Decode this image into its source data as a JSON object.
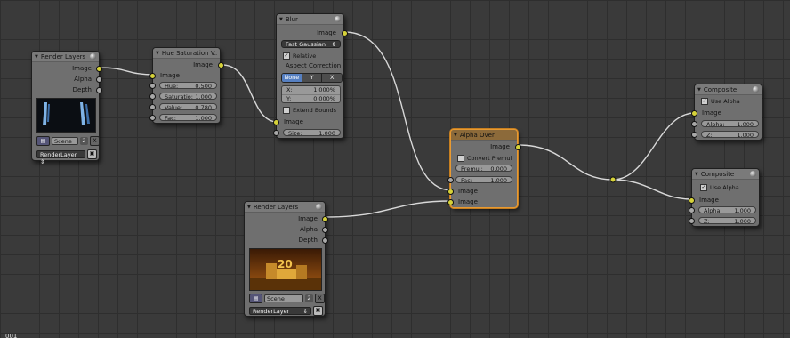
{
  "frame_label": "001",
  "nodes": {
    "render_layers_1": {
      "title": "Render Layers",
      "outputs": [
        "Image",
        "Alpha",
        "Depth"
      ],
      "scene": {
        "icon": "scene-icon",
        "name": "Scene",
        "count": "2",
        "close": "X"
      },
      "layer": {
        "name": "RenderLayer",
        "arrows": "⇕"
      }
    },
    "hue_saturation": {
      "title": "Hue Saturation V...",
      "output": "Image",
      "input": "Image",
      "fields": [
        {
          "label": "Hue:",
          "value": "0.500"
        },
        {
          "label": "Saturatio:",
          "value": "1.000"
        },
        {
          "label": "Value:",
          "value": "0.780"
        },
        {
          "label": "Fac:",
          "value": "1.000"
        }
      ]
    },
    "blur": {
      "title": "Blur",
      "output": "Image",
      "filter_type": "Fast Gaussian",
      "relative_label": "Relative",
      "relative_checked": true,
      "aspect_label": "Aspect Correction",
      "aspect_options": [
        "None",
        "Y",
        "X"
      ],
      "aspect_selected": "None",
      "xy": [
        {
          "label": "X:",
          "value": "1.000%"
        },
        {
          "label": "Y:",
          "value": "0.000%"
        }
      ],
      "extend_bounds_label": "Extend Bounds",
      "extend_bounds_checked": false,
      "input": "Image",
      "size": {
        "label": "Size:",
        "value": "1.000"
      }
    },
    "alpha_over": {
      "title": "Alpha Over",
      "output": "Image",
      "convert_premul_label": "Convert Premul",
      "convert_premul_checked": false,
      "premul": {
        "label": "Premul:",
        "value": "0.000"
      },
      "fac": {
        "label": "Fac:",
        "value": "1.000"
      },
      "inputs": [
        "Image",
        "Image"
      ]
    },
    "render_layers_2": {
      "title": "Render Layers",
      "outputs": [
        "Image",
        "Alpha",
        "Depth"
      ],
      "thumbnail_label": "20",
      "scene": {
        "icon": "scene-icon",
        "name": "Scene",
        "count": "2",
        "close": "X"
      },
      "layer": {
        "name": "RenderLayer",
        "arrows": "⇕"
      }
    },
    "composite_1": {
      "title": "Composite",
      "use_alpha_label": "Use Alpha",
      "use_alpha_checked": true,
      "input": "Image",
      "fields": [
        {
          "label": "Alpha:",
          "value": "1.000"
        },
        {
          "label": "Z:",
          "value": "1.000"
        }
      ]
    },
    "composite_2": {
      "title": "Composite",
      "use_alpha_label": "Use Alpha",
      "use_alpha_checked": true,
      "input": "Image",
      "fields": [
        {
          "label": "Alpha:",
          "value": "1.000"
        },
        {
          "label": "Z:",
          "value": "1.000"
        }
      ]
    }
  },
  "colors": {
    "background": "#3a3a3a",
    "grid": "#2e2e2e",
    "node_body": "#6f6f6f",
    "active_outline": "#e89a32",
    "socket_color": "#d6d23a",
    "socket_value": "#a8a8a8",
    "link": "#d8d8d8"
  }
}
